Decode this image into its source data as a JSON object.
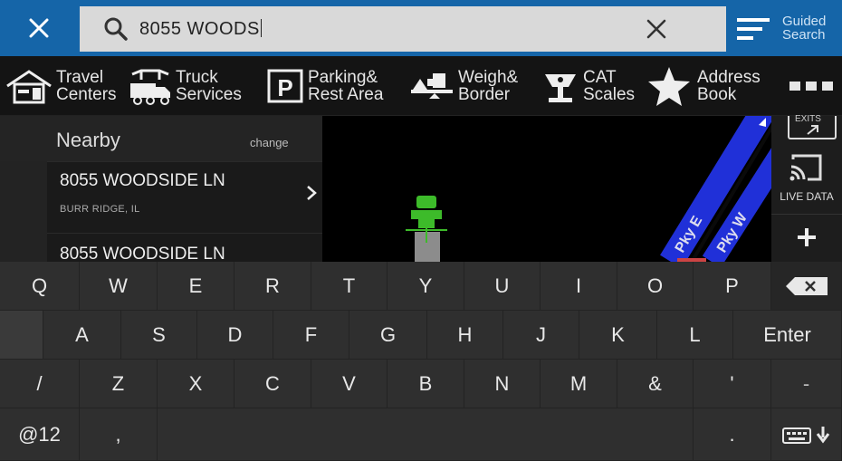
{
  "search": {
    "value": "8055 WOODS"
  },
  "guided_search": {
    "label": "Guided Search"
  },
  "categories": [
    {
      "label": "Travel\nCenters",
      "icon": "travel-center-icon"
    },
    {
      "label": "Truck\nServices",
      "icon": "truck-service-icon"
    },
    {
      "label": "Parking&\nRest Area",
      "icon": "parking-icon"
    },
    {
      "label": "Weigh&\nBorder",
      "icon": "weigh-station-icon"
    },
    {
      "label": "CAT\nScales",
      "icon": "cat-scale-icon"
    },
    {
      "label": "Address\nBook",
      "icon": "star-icon"
    }
  ],
  "nearby": {
    "title": "Nearby",
    "change_label": "change",
    "results": [
      {
        "title": "8055 WOODSIDE LN",
        "subtitle": "BURR RIDGE, IL"
      },
      {
        "title": "8055 WOODSIDE LN",
        "subtitle": ""
      }
    ]
  },
  "map": {
    "road_label_1": "Pky E",
    "road_label_2": "Pky W",
    "exit_label": "EXITS",
    "live_data_label": "LIVE DATA"
  },
  "keyboard": {
    "row1": [
      "Q",
      "W",
      "E",
      "R",
      "T",
      "Y",
      "U",
      "I",
      "O",
      "P"
    ],
    "row2": [
      "A",
      "S",
      "D",
      "F",
      "G",
      "H",
      "J",
      "K",
      "L"
    ],
    "enter_label": "Enter",
    "row3": [
      "/",
      "Z",
      "X",
      "C",
      "V",
      "B",
      "N",
      "M",
      "&",
      "'",
      "-"
    ],
    "row4_left": "@12",
    "row4_comma": ",",
    "row4_period": "."
  },
  "colors": {
    "topbar": "#1565a8",
    "accent_green": "#3dbb2a",
    "road_blue": "#1d2fd6"
  }
}
